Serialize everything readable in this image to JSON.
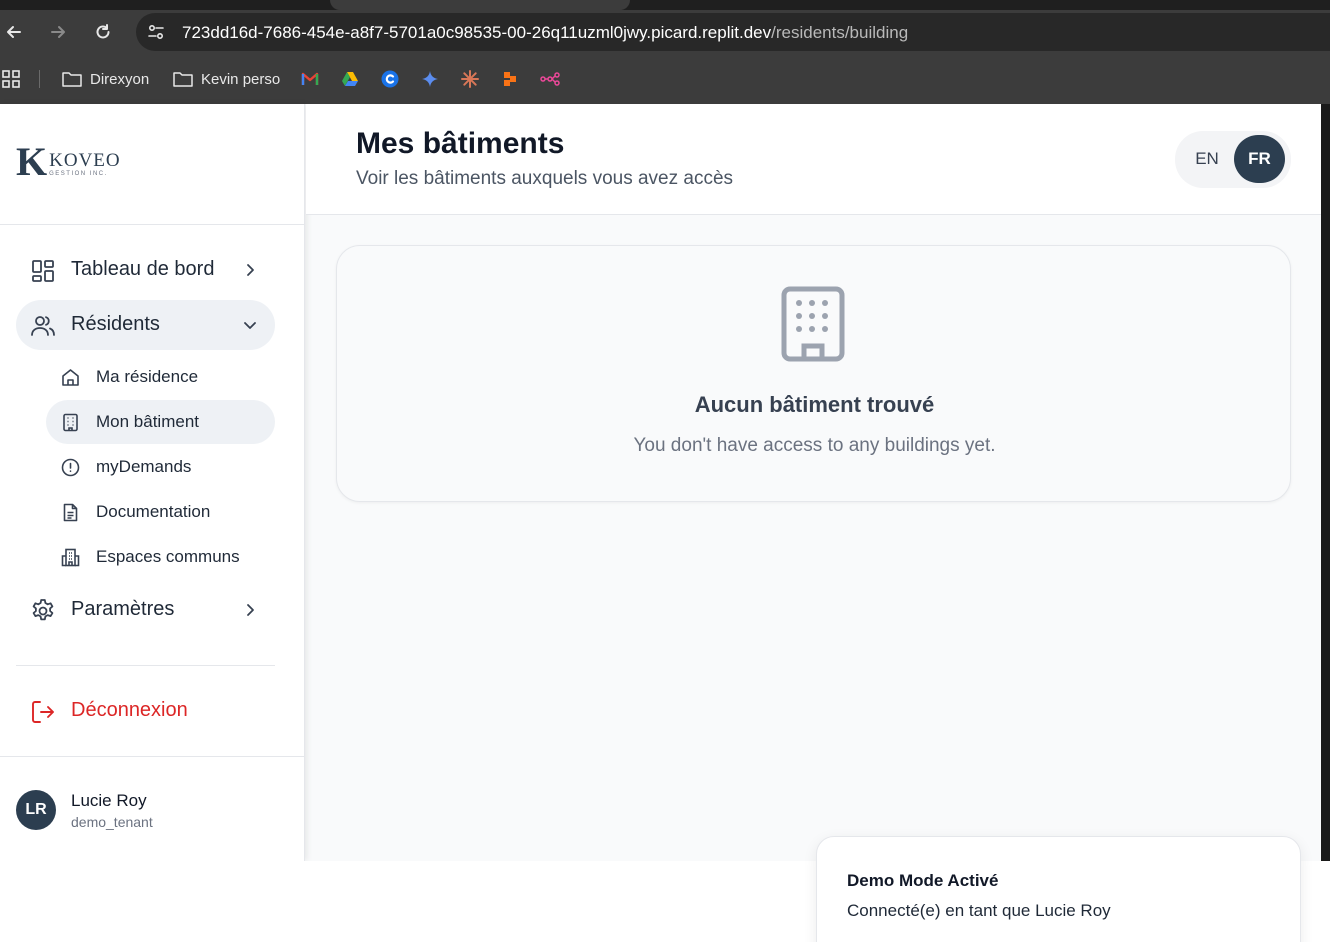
{
  "browser": {
    "url_host": "723dd16d-7686-454e-a8f7-5701a0c98535-00-26q11uzml0jwy.picard.replit.dev",
    "url_path": "/residents/building",
    "bookmarks": [
      {
        "label": "Direxyon",
        "icon": "folder-icon"
      },
      {
        "label": "Kevin perso",
        "icon": "folder-icon"
      }
    ],
    "bookmark_icons": [
      "gmail-icon",
      "google-drive-icon",
      "c-app-icon",
      "gemini-icon",
      "claude-icon",
      "figma-like-icon",
      "flow-icon"
    ]
  },
  "sidebar": {
    "logo": {
      "mark": "K",
      "brand": "KOVEO",
      "sub": "GESTION INC."
    },
    "items": [
      {
        "label": "Tableau de bord",
        "icon": "dashboard-icon"
      },
      {
        "label": "Résidents",
        "icon": "users-icon"
      },
      {
        "label": "Paramètres",
        "icon": "gear-icon"
      }
    ],
    "sub_items": [
      {
        "label": "Ma résidence",
        "icon": "home-icon"
      },
      {
        "label": "Mon bâtiment",
        "icon": "building-icon"
      },
      {
        "label": "myDemands",
        "icon": "alert-circle-icon"
      },
      {
        "label": "Documentation",
        "icon": "document-icon"
      },
      {
        "label": "Espaces communs",
        "icon": "buildings-icon"
      }
    ],
    "logout_label": "Déconnexion",
    "user": {
      "initials": "LR",
      "name": "Lucie Roy",
      "role": "demo_tenant"
    }
  },
  "header": {
    "title": "Mes bâtiments",
    "subtitle": "Voir les bâtiments auxquels vous avez accès",
    "lang": {
      "en": "EN",
      "fr": "FR",
      "selected": "FR"
    }
  },
  "empty_state": {
    "title": "Aucun bâtiment trouvé",
    "message": "You don't have access to any buildings yet."
  },
  "toast": {
    "title": "Demo Mode Activé",
    "message": "Connecté(e) en tant que Lucie Roy"
  },
  "colors": {
    "brand": "#2c3e50",
    "logout": "#dc2626",
    "active_bg": "#eef1f5"
  }
}
